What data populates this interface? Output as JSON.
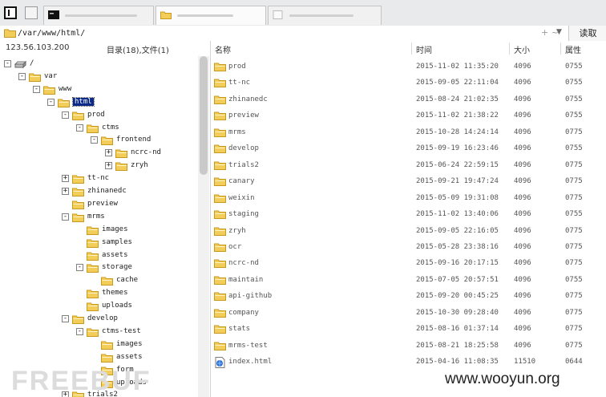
{
  "path": "/var/www/html/",
  "read_label": "读取",
  "plusminus": "+ ~",
  "dropdown": "▼",
  "left_header": {
    "ip": "123.56.103.200",
    "counts": "目录(18),文件(1)"
  },
  "columns": {
    "name": "名称",
    "time": "时间",
    "size": "大小",
    "attr": "属性"
  },
  "tree": [
    {
      "label": "/",
      "depth": 0,
      "toggle": "-",
      "icon": "drive-icon"
    },
    {
      "label": "var",
      "depth": 1,
      "toggle": "-",
      "icon": "folder-icon"
    },
    {
      "label": "www",
      "depth": 2,
      "toggle": "-",
      "icon": "folder-icon"
    },
    {
      "label": "html",
      "depth": 3,
      "toggle": "-",
      "icon": "folder-icon",
      "selected": true
    },
    {
      "label": "prod",
      "depth": 4,
      "toggle": "-",
      "icon": "folder-icon"
    },
    {
      "label": "ctms",
      "depth": 5,
      "toggle": "-",
      "icon": "folder-icon"
    },
    {
      "label": "frontend",
      "depth": 6,
      "toggle": "-",
      "icon": "folder-icon"
    },
    {
      "label": "ncrc-nd",
      "depth": 7,
      "toggle": "+",
      "icon": "folder-icon"
    },
    {
      "label": "zryh",
      "depth": 7,
      "toggle": "+",
      "icon": "folder-icon"
    },
    {
      "label": "tt-nc",
      "depth": 4,
      "toggle": "+",
      "icon": "folder-icon"
    },
    {
      "label": "zhinanedc",
      "depth": 4,
      "toggle": "+",
      "icon": "folder-icon"
    },
    {
      "label": "preview",
      "depth": 4,
      "toggle": "",
      "icon": "folder-icon"
    },
    {
      "label": "mrms",
      "depth": 4,
      "toggle": "-",
      "icon": "folder-icon"
    },
    {
      "label": "images",
      "depth": 5,
      "toggle": "",
      "icon": "folder-icon"
    },
    {
      "label": "samples",
      "depth": 5,
      "toggle": "",
      "icon": "folder-icon"
    },
    {
      "label": "assets",
      "depth": 5,
      "toggle": "",
      "icon": "folder-icon"
    },
    {
      "label": "storage",
      "depth": 5,
      "toggle": "-",
      "icon": "folder-icon"
    },
    {
      "label": "cache",
      "depth": 6,
      "toggle": "",
      "icon": "folder-icon"
    },
    {
      "label": "themes",
      "depth": 5,
      "toggle": "",
      "icon": "folder-icon"
    },
    {
      "label": "uploads",
      "depth": 5,
      "toggle": "",
      "icon": "folder-icon"
    },
    {
      "label": "develop",
      "depth": 4,
      "toggle": "-",
      "icon": "folder-icon"
    },
    {
      "label": "ctms-test",
      "depth": 5,
      "toggle": "-",
      "icon": "folder-icon"
    },
    {
      "label": "images",
      "depth": 6,
      "toggle": "",
      "icon": "folder-icon"
    },
    {
      "label": "assets",
      "depth": 6,
      "toggle": "",
      "icon": "folder-icon"
    },
    {
      "label": "form",
      "depth": 6,
      "toggle": "",
      "icon": "folder-icon"
    },
    {
      "label": "uploads",
      "depth": 6,
      "toggle": "",
      "icon": "folder-icon"
    },
    {
      "label": "trials2",
      "depth": 4,
      "toggle": "+",
      "icon": "folder-icon"
    }
  ],
  "files": [
    {
      "name": "prod",
      "time": "2015-11-02 11:35:20",
      "size": "4096",
      "attr": "0755",
      "icon": "folder-icon"
    },
    {
      "name": "tt-nc",
      "time": "2015-09-05 22:11:04",
      "size": "4096",
      "attr": "0755",
      "icon": "folder-icon"
    },
    {
      "name": "zhinanedc",
      "time": "2015-08-24 21:02:35",
      "size": "4096",
      "attr": "0755",
      "icon": "folder-icon"
    },
    {
      "name": "preview",
      "time": "2015-11-02 21:38:22",
      "size": "4096",
      "attr": "0755",
      "icon": "folder-icon"
    },
    {
      "name": "mrms",
      "time": "2015-10-28 14:24:14",
      "size": "4096",
      "attr": "0775",
      "icon": "folder-icon"
    },
    {
      "name": "develop",
      "time": "2015-09-19 16:23:46",
      "size": "4096",
      "attr": "0755",
      "icon": "folder-icon"
    },
    {
      "name": "trials2",
      "time": "2015-06-24 22:59:15",
      "size": "4096",
      "attr": "0775",
      "icon": "folder-icon"
    },
    {
      "name": "canary",
      "time": "2015-09-21 19:47:24",
      "size": "4096",
      "attr": "0775",
      "icon": "folder-icon"
    },
    {
      "name": "weixin",
      "time": "2015-05-09 19:31:08",
      "size": "4096",
      "attr": "0775",
      "icon": "folder-icon"
    },
    {
      "name": "staging",
      "time": "2015-11-02 13:40:06",
      "size": "4096",
      "attr": "0755",
      "icon": "folder-icon"
    },
    {
      "name": "zryh",
      "time": "2015-09-05 22:16:05",
      "size": "4096",
      "attr": "0775",
      "icon": "folder-icon"
    },
    {
      "name": "ocr",
      "time": "2015-05-28 23:38:16",
      "size": "4096",
      "attr": "0775",
      "icon": "folder-icon"
    },
    {
      "name": "ncrc-nd",
      "time": "2015-09-16 20:17:15",
      "size": "4096",
      "attr": "0775",
      "icon": "folder-icon"
    },
    {
      "name": "maintain",
      "time": "2015-07-05 20:57:51",
      "size": "4096",
      "attr": "0755",
      "icon": "folder-icon"
    },
    {
      "name": "api-github",
      "time": "2015-09-20 00:45:25",
      "size": "4096",
      "attr": "0775",
      "icon": "folder-icon"
    },
    {
      "name": "company",
      "time": "2015-10-30 09:28:40",
      "size": "4096",
      "attr": "0775",
      "icon": "folder-icon"
    },
    {
      "name": "stats",
      "time": "2015-08-16 01:37:14",
      "size": "4096",
      "attr": "0775",
      "icon": "folder-icon"
    },
    {
      "name": "mrms-test",
      "time": "2015-08-21 18:25:58",
      "size": "4096",
      "attr": "0775",
      "icon": "folder-icon"
    },
    {
      "name": "index.html",
      "time": "2015-04-16 11:08:35",
      "size": "11510",
      "attr": "0644",
      "icon": "html-file-icon"
    }
  ],
  "watermark": "www.wooyun.org",
  "watermark2": "FREEBUF",
  "colors": {
    "folder": "#f3cd5a",
    "folder_edge": "#c79a1e",
    "selected": "#0b2a8a"
  }
}
